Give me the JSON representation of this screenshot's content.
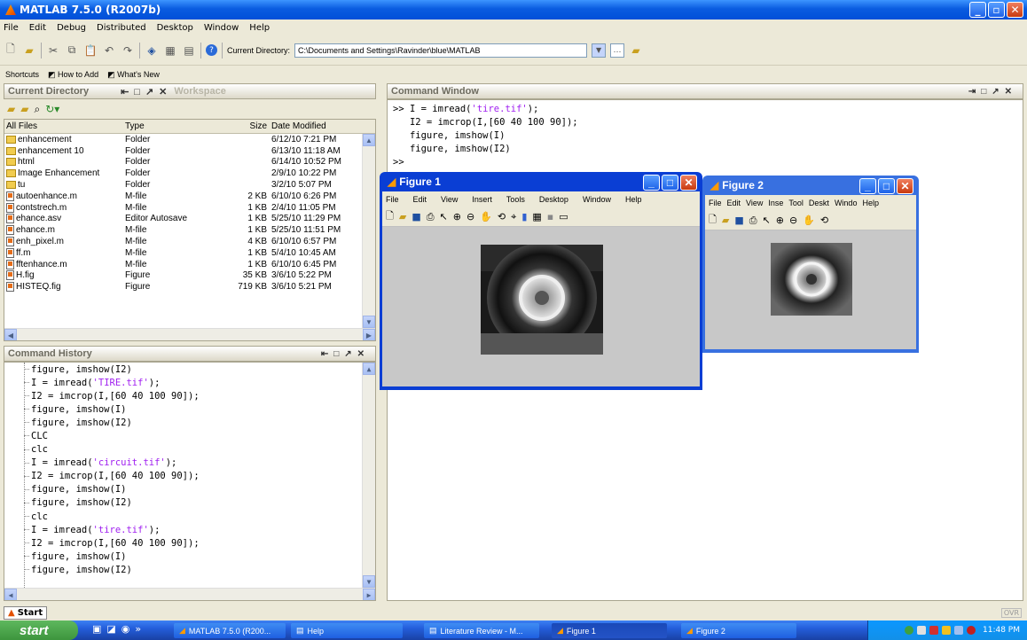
{
  "window": {
    "title": "MATLAB 7.5.0 (R2007b)"
  },
  "menu": [
    "File",
    "Edit",
    "Debug",
    "Distributed",
    "Desktop",
    "Window",
    "Help"
  ],
  "toolbar": {
    "curdir_label": "Current Directory:",
    "curdir_value": "C:\\Documents and Settings\\Ravinder\\blue\\MATLAB"
  },
  "shortcuts": {
    "label": "Shortcuts",
    "how_to_add": "How to Add",
    "whats_new": "What's New"
  },
  "current_directory": {
    "title": "Current Directory",
    "workspace_tab": "Workspace",
    "columns": [
      "All Files",
      "Type",
      "Size",
      "Date Modified"
    ],
    "files": [
      {
        "name": "enhancement",
        "type": "Folder",
        "size": "",
        "date": "6/12/10 7:21 PM",
        "icon": "folder"
      },
      {
        "name": "enhancement 10",
        "type": "Folder",
        "size": "",
        "date": "6/13/10 11:18 AM",
        "icon": "folder"
      },
      {
        "name": "html",
        "type": "Folder",
        "size": "",
        "date": "6/14/10 10:52 PM",
        "icon": "folder"
      },
      {
        "name": "Image Enhancement",
        "type": "Folder",
        "size": "",
        "date": "2/9/10 10:22 PM",
        "icon": "folder"
      },
      {
        "name": "tu",
        "type": "Folder",
        "size": "",
        "date": "3/2/10 5:07 PM",
        "icon": "folder"
      },
      {
        "name": "autoenhance.m",
        "type": "M-file",
        "size": "2 KB",
        "date": "6/10/10 6:26 PM",
        "icon": "mfile"
      },
      {
        "name": "contstrech.m",
        "type": "M-file",
        "size": "1 KB",
        "date": "2/4/10 11:05 PM",
        "icon": "mfile"
      },
      {
        "name": "ehance.asv",
        "type": "Editor Autosave",
        "size": "1 KB",
        "date": "5/25/10 11:29 PM",
        "icon": "mfile"
      },
      {
        "name": "ehance.m",
        "type": "M-file",
        "size": "1 KB",
        "date": "5/25/10 11:51 PM",
        "icon": "mfile"
      },
      {
        "name": "enh_pixel.m",
        "type": "M-file",
        "size": "4 KB",
        "date": "6/10/10 6:57 PM",
        "icon": "mfile"
      },
      {
        "name": "ff.m",
        "type": "M-file",
        "size": "1 KB",
        "date": "5/4/10 10:45 AM",
        "icon": "mfile"
      },
      {
        "name": "fftenhance.m",
        "type": "M-file",
        "size": "1 KB",
        "date": "6/10/10 6:45 PM",
        "icon": "mfile"
      },
      {
        "name": "H.fig",
        "type": "Figure",
        "size": "35 KB",
        "date": "3/6/10 5:22 PM",
        "icon": "mfile"
      },
      {
        "name": "HISTEQ.fig",
        "type": "Figure",
        "size": "719 KB",
        "date": "3/6/10 5:21 PM",
        "icon": "mfile"
      }
    ]
  },
  "command_history": {
    "title": "Command History",
    "lines": [
      "figure, imshow(I2)",
      "I = imread('TIRE.tif');",
      "I2 = imcrop(I,[60 40 100 90]);",
      "figure, imshow(I)",
      "figure, imshow(I2)",
      "CLC",
      "clc",
      "I = imread('circuit.tif');",
      "I2 = imcrop(I,[60 40 100 90]);",
      "figure, imshow(I)",
      "figure, imshow(I2)",
      "clc",
      "I = imread('tire.tif');",
      "I2 = imcrop(I,[60 40 100 90]);",
      "figure, imshow(I)",
      "figure, imshow(I2)"
    ]
  },
  "command_window": {
    "title": "Command Window",
    "lines": [
      ">> I = imread('tire.tif');",
      "   I2 = imcrop(I,[60 40 100 90]);",
      "   figure, imshow(I)",
      "   figure, imshow(I2)",
      ">>"
    ]
  },
  "figure1": {
    "title": "Figure 1",
    "menu": [
      "File",
      "Edit",
      "View",
      "Insert",
      "Tools",
      "Desktop",
      "Window",
      "Help"
    ]
  },
  "figure2": {
    "title": "Figure 2",
    "menu": [
      "File",
      "Edit",
      "View",
      "Inse",
      "Tool",
      "Deskt",
      "Windo",
      "Help"
    ]
  },
  "statusbar": {
    "start": "Start",
    "ovr": "OVR"
  },
  "taskbar": {
    "start": "start",
    "tasks": [
      "MATLAB 7.5.0 (R200...",
      "Help",
      "Literature Review - M...",
      "Figure 1",
      "Figure 2"
    ],
    "clock": "11:48 PM"
  }
}
